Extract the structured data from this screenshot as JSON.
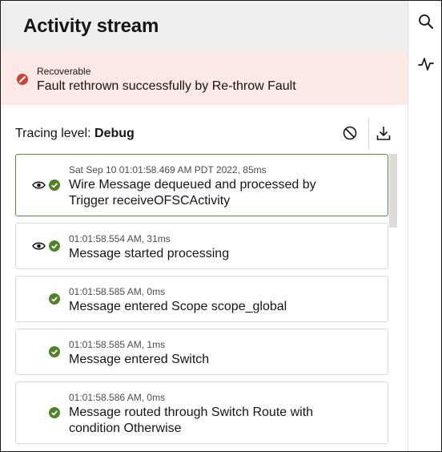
{
  "panel": {
    "title": "Activity stream"
  },
  "banner": {
    "severity": "Recoverable",
    "message": "Fault rethrown successfully by Re-throw Fault",
    "icon": "error-circle-icon",
    "color": "#fce9e6"
  },
  "tracing": {
    "label": "Tracing level:",
    "value": "Debug"
  },
  "toolbar": {
    "clear_icon": "clear-icon",
    "download_icon": "download-icon"
  },
  "rail": {
    "icons": [
      "search-icon",
      "activity-icon"
    ]
  },
  "colors": {
    "success": "#508228",
    "selected_border": "#5a8a30",
    "error": "#c74634"
  },
  "activities": [
    {
      "meta": "Sat Sep 10 01:01:58.469 AM PDT 2022, 85ms",
      "line1": "Wire Message dequeued and processed by",
      "line2": "Trigger receiveOFSCActivity",
      "has_view": true
    },
    {
      "meta": "01:01:58.554 AM, 31ms",
      "line1": "Message started processing",
      "has_view": true
    },
    {
      "meta": "01:01:58.585 AM, 0ms",
      "line1": "Message entered Scope scope_global",
      "has_view": false
    },
    {
      "meta": "01:01:58.585 AM, 1ms",
      "line1": "Message entered Switch",
      "has_view": false
    },
    {
      "meta": "01:01:58.586 AM, 0ms",
      "line1": "Message routed through Switch Route with",
      "line2": "condition Otherwise",
      "has_view": false
    }
  ]
}
